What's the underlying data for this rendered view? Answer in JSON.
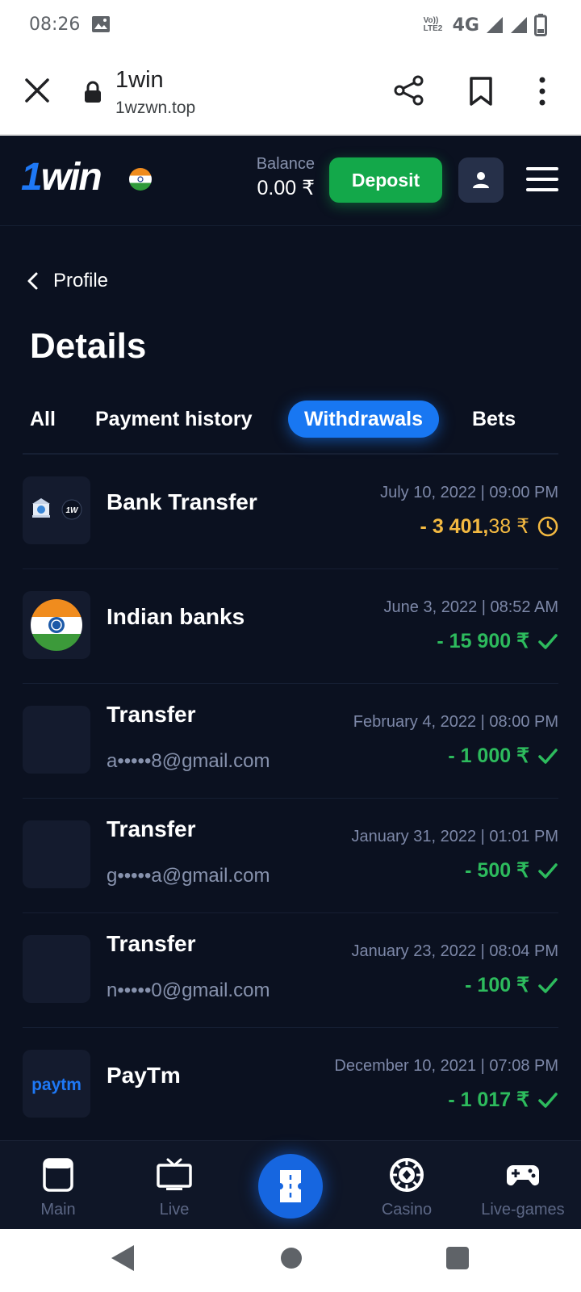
{
  "status_bar": {
    "time": "08:26",
    "volte_line1": "Vo))",
    "volte_line2": "LTE2",
    "network": "4G"
  },
  "browser": {
    "title": "1win",
    "url": "1wzwn.top"
  },
  "header": {
    "logo_one": "1",
    "logo_win": "win",
    "balance_label": "Balance",
    "balance_value": "0.00 ₹",
    "deposit_label": "Deposit"
  },
  "nav_back": {
    "label": "Profile"
  },
  "page_title": "Details",
  "tabs": [
    {
      "label": "All",
      "active": false
    },
    {
      "label": "Payment history",
      "active": false
    },
    {
      "label": "Withdrawals",
      "active": true
    },
    {
      "label": "Bets",
      "active": false
    }
  ],
  "transactions": [
    {
      "name": "Bank Transfer",
      "email": "",
      "date": "July 10, 2022 | 09:00 PM",
      "amount_main": "- 3 401,",
      "amount_decimal": "38 ₹",
      "status": "pending",
      "icon": "bank-1w-icon"
    },
    {
      "name": "Indian banks",
      "email": "",
      "date": "June 3, 2022 | 08:52 AM",
      "amount_main": "- 15 900 ₹",
      "amount_decimal": "",
      "status": "completed",
      "icon": "india-flag-icon"
    },
    {
      "name": "Transfer",
      "email": "a•••••8@gmail.com",
      "date": "February 4, 2022 | 08:00 PM",
      "amount_main": "- 1 000 ₹",
      "amount_decimal": "",
      "status": "completed",
      "icon": "blank-icon"
    },
    {
      "name": "Transfer",
      "email": "g•••••a@gmail.com",
      "date": "January 31, 2022 | 01:01 PM",
      "amount_main": "- 500 ₹",
      "amount_decimal": "",
      "status": "completed",
      "icon": "blank-icon"
    },
    {
      "name": "Transfer",
      "email": "n•••••0@gmail.com",
      "date": "January 23, 2022 | 08:04 PM",
      "amount_main": "- 100 ₹",
      "amount_decimal": "",
      "status": "completed",
      "icon": "blank-icon"
    },
    {
      "name": "PayTm",
      "email": "",
      "date": "December 10, 2021 | 07:08 PM",
      "amount_main": "- 1 017 ₹",
      "amount_decimal": "",
      "status": "completed",
      "icon": "paytm-logo-icon",
      "icon_text": "paytm"
    }
  ],
  "bottom_nav": [
    {
      "label": "Main",
      "icon": "main-icon"
    },
    {
      "label": "Live",
      "icon": "tv-icon"
    },
    {
      "label": "",
      "icon": "ticket-icon"
    },
    {
      "label": "Casino",
      "icon": "casino-chip-icon"
    },
    {
      "label": "Live-games",
      "icon": "gamepad-icon"
    }
  ],
  "colors": {
    "background": "#0b1120",
    "accent": "#1877f2",
    "deposit": "#13a84a",
    "success": "#2dbb5d",
    "pending": "#f3b941"
  }
}
